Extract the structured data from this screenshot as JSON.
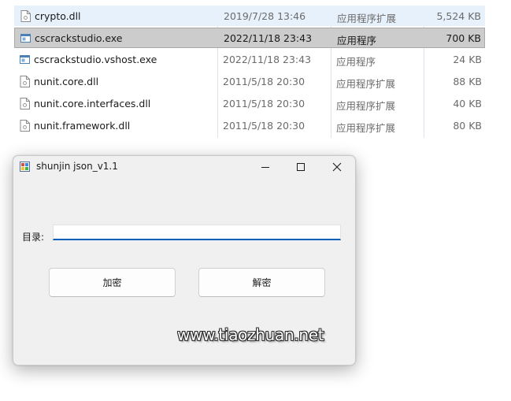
{
  "explorer": {
    "files": [
      {
        "name": "crypto.dll",
        "date": "2019/7/28 13:46",
        "type": "应用程序扩展",
        "size": "5,524 KB",
        "icon": "dll-file-icon",
        "state": "hovered"
      },
      {
        "name": "cscrackstudio.exe",
        "date": "2022/11/18 23:43",
        "type": "应用程序",
        "size": "700 KB",
        "icon": "exe-file-icon",
        "state": "selected"
      },
      {
        "name": "cscrackstudio.vshost.exe",
        "date": "2022/11/18 23:43",
        "type": "应用程序",
        "size": "24 KB",
        "icon": "exe-file-icon",
        "state": "normal"
      },
      {
        "name": "nunit.core.dll",
        "date": "2011/5/18 20:30",
        "type": "应用程序扩展",
        "size": "88 KB",
        "icon": "dll-file-icon",
        "state": "normal"
      },
      {
        "name": "nunit.core.interfaces.dll",
        "date": "2011/5/18 20:30",
        "type": "应用程序扩展",
        "size": "40 KB",
        "icon": "dll-file-icon",
        "state": "normal"
      },
      {
        "name": "nunit.framework.dll",
        "date": "2011/5/18 20:30",
        "type": "应用程序扩展",
        "size": "80 KB",
        "icon": "dll-file-icon",
        "state": "normal"
      }
    ]
  },
  "app_window": {
    "title": "shunjin json_v1.1",
    "icon": "winforms-app-icon",
    "directory_label": "目录:",
    "directory_value": "",
    "encrypt_label": "加密",
    "decrypt_label": "解密"
  },
  "watermark": {
    "text": "www.tiaozhuan.net"
  },
  "colors": {
    "input_accent": "#005fb8",
    "selected_row": "#cccccc",
    "hover_row": "#e7f1fb",
    "window_background": "#f0f0f0"
  }
}
